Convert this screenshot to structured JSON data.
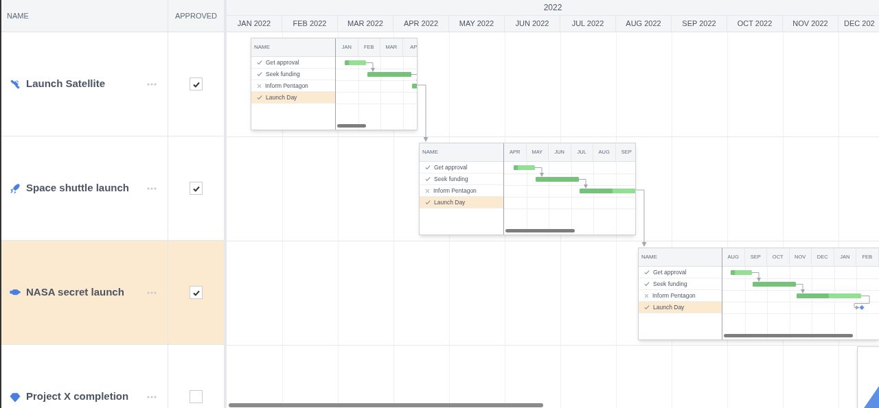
{
  "columns": [
    {
      "label": "NAME"
    },
    {
      "label": "APPROVED"
    }
  ],
  "timeline": {
    "year": "2022",
    "months": [
      "JAN 2022",
      "FEB 2022",
      "MAR 2022",
      "APR 2022",
      "MAY 2022",
      "JUN 2022",
      "JUL 2022",
      "AUG 2022",
      "SEP 2022",
      "OCT 2022",
      "NOV 2022",
      "DEC 202"
    ]
  },
  "rows": [
    {
      "name": "Launch Satellite",
      "kind": "satellite",
      "approved": true,
      "selected": false,
      "subgantt": {
        "name_header": "NAME",
        "months": [
          "JAN",
          "FEB",
          "MAR",
          "AP"
        ],
        "tasks": [
          {
            "name": "Get approval",
            "done": true,
            "selected": false,
            "level": 0.2
          },
          {
            "name": "Seek funding",
            "done": true,
            "selected": false,
            "level": 1
          },
          {
            "name": "Inform Pentagon",
            "done": false,
            "selected": false,
            "level": 1
          },
          {
            "name": "Launch Day",
            "done": true,
            "selected": true
          }
        ]
      }
    },
    {
      "name": "Space shuttle launch",
      "kind": "rocket",
      "approved": true,
      "selected": false,
      "subgantt": {
        "name_header": "NAME",
        "months": [
          "APR",
          "MAY",
          "JUN",
          "JUL",
          "AUG",
          "SEP"
        ],
        "tasks": [
          {
            "name": "Get approval",
            "done": true,
            "selected": false,
            "level": 0.2
          },
          {
            "name": "Seek funding",
            "done": true,
            "selected": false,
            "level": 1
          },
          {
            "name": "Inform Pentagon",
            "done": false,
            "selected": false,
            "level": 0.57
          },
          {
            "name": "Launch Day",
            "done": true,
            "selected": true
          }
        ]
      }
    },
    {
      "name": "NASA secret launch",
      "kind": "shuttle",
      "approved": true,
      "selected": true,
      "subgantt": {
        "name_header": "NAME",
        "months": [
          "AUG",
          "SEP",
          "OCT",
          "NOV",
          "DEC",
          "JAN",
          "FEB"
        ],
        "tasks": [
          {
            "name": "Get approval",
            "done": true,
            "selected": false,
            "level": 0.2
          },
          {
            "name": "Seek funding",
            "done": true,
            "selected": false,
            "level": 1
          },
          {
            "name": "Inform Pentagon",
            "done": false,
            "selected": false,
            "level": 0.5
          },
          {
            "name": "Launch Day",
            "done": true,
            "selected": true
          }
        ]
      }
    },
    {
      "name": "Project X completion",
      "kind": "diamond",
      "approved": false,
      "selected": false
    }
  ]
}
